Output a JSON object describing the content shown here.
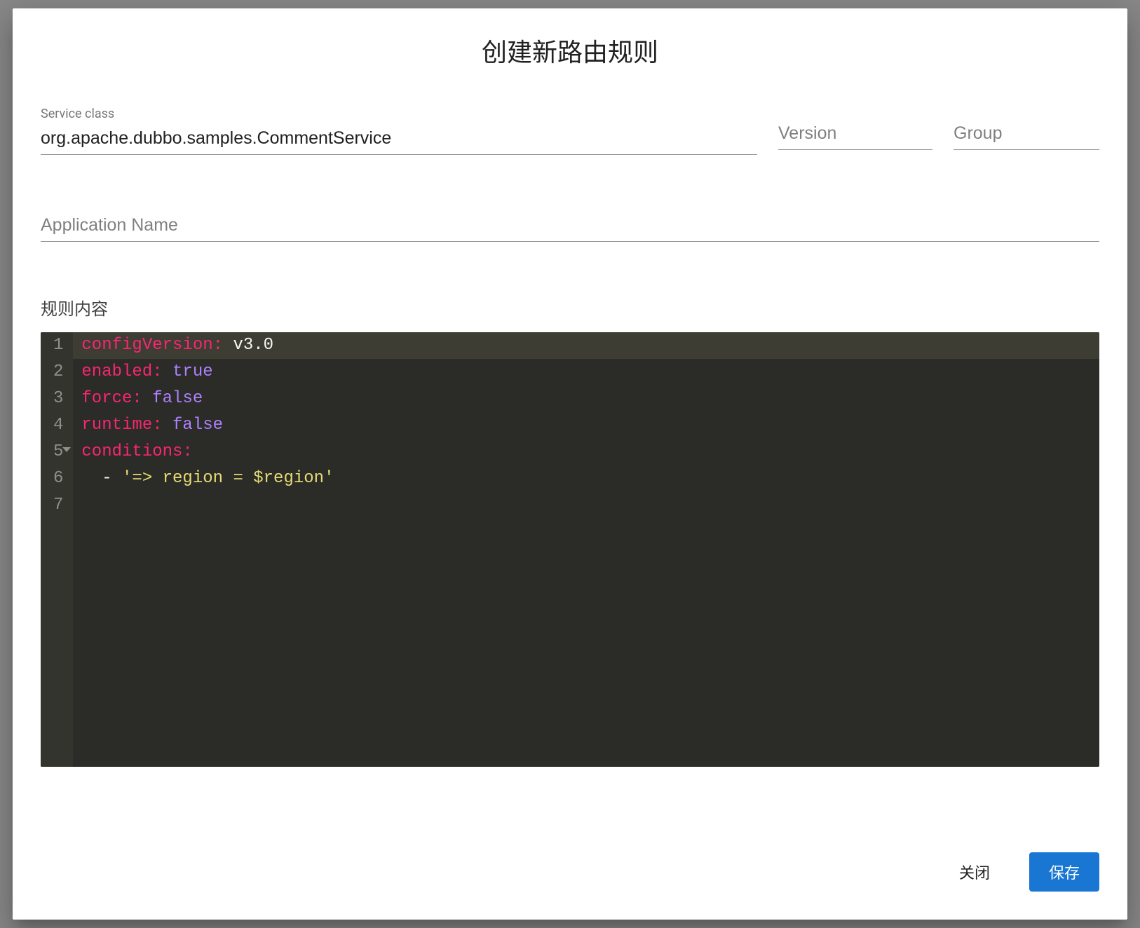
{
  "dialog": {
    "title": "创建新路由规则"
  },
  "fields": {
    "service_class": {
      "label": "Service class",
      "value": "org.apache.dubbo.samples.CommentService"
    },
    "version": {
      "placeholder": "Version",
      "value": ""
    },
    "group": {
      "placeholder": "Group",
      "value": ""
    },
    "application_name": {
      "placeholder": "Application Name",
      "value": ""
    }
  },
  "rule_section": {
    "label": "规则内容"
  },
  "editor": {
    "line_numbers": [
      "1",
      "2",
      "3",
      "4",
      "5",
      "6",
      "7"
    ],
    "fold_line_index": 4,
    "active_line_index": 0,
    "lines": [
      [
        {
          "cls": "tok-key",
          "t": "configVersion:"
        },
        {
          "cls": "tok-plain",
          "t": " v3.0"
        }
      ],
      [
        {
          "cls": "tok-key",
          "t": "enabled:"
        },
        {
          "cls": "tok-plain",
          "t": " "
        },
        {
          "cls": "tok-bool",
          "t": "true"
        }
      ],
      [
        {
          "cls": "tok-key",
          "t": "force:"
        },
        {
          "cls": "tok-plain",
          "t": " "
        },
        {
          "cls": "tok-bool",
          "t": "false"
        }
      ],
      [
        {
          "cls": "tok-key",
          "t": "runtime:"
        },
        {
          "cls": "tok-plain",
          "t": " "
        },
        {
          "cls": "tok-bool",
          "t": "false"
        }
      ],
      [
        {
          "cls": "tok-key",
          "t": "conditions:"
        }
      ],
      [
        {
          "cls": "tok-plain",
          "t": "  - "
        },
        {
          "cls": "tok-str",
          "t": "'=> region = $region'"
        }
      ],
      []
    ],
    "raw": "configVersion: v3.0\nenabled: true\nforce: false\nruntime: false\nconditions:\n  - '=> region = $region'\n"
  },
  "actions": {
    "close": "关闭",
    "save": "保存"
  },
  "colors": {
    "primary": "#1976d2",
    "editor_bg": "#2b2b28",
    "gutter_bg": "#34342f",
    "active_line": "#3e3d33",
    "tok_key": "#f92672",
    "tok_bool": "#ae81ff",
    "tok_str": "#e6db74"
  }
}
